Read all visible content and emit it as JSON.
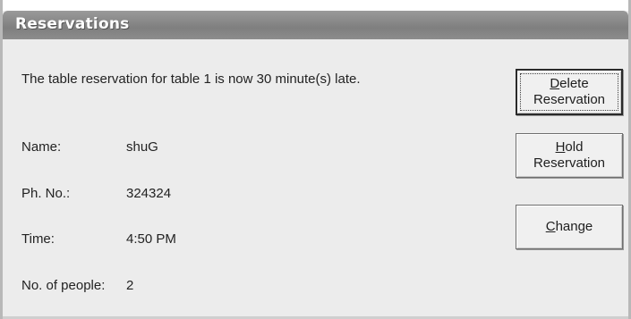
{
  "window": {
    "title": "Reservations"
  },
  "message": "The table reservation for table 1 is now 30 minute(s) late.",
  "details": [
    {
      "label": "Name:",
      "value": "shuG"
    },
    {
      "label": "Ph. No.:",
      "value": "324324"
    },
    {
      "label": "Time:",
      "value": "4:50 PM"
    },
    {
      "label": "No. of people:",
      "value": "2"
    }
  ],
  "buttons": {
    "delete": {
      "accel": "D",
      "rest_line1": "elete",
      "line2": "Reservation"
    },
    "hold": {
      "accel": "H",
      "rest_line1": "old",
      "line2": "Reservation"
    },
    "change": {
      "accel": "C",
      "rest_line1": "hange"
    }
  },
  "colors": {
    "titlebar": "#8a8a8a",
    "dialog_bg": "#ececec"
  }
}
